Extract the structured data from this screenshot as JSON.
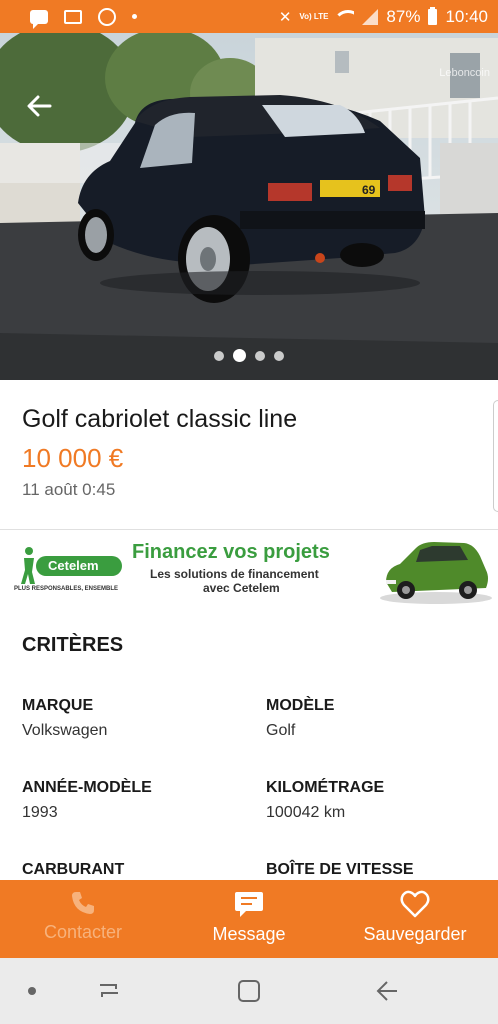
{
  "status_bar": {
    "battery": "87%",
    "time": "10:40",
    "network_label": "Vo) LTE",
    "notification_icons": [
      "chat-icon",
      "news-icon",
      "sync-icon",
      "dot-icon"
    ],
    "system_icons": [
      "mute-icon",
      "lte-icon",
      "wifi-icon",
      "signal-icon",
      "battery-icon"
    ]
  },
  "hero": {
    "watermark": "Leboncoin",
    "image_count": 4,
    "active_index": 1
  },
  "listing": {
    "title": "Golf cabriolet classic line",
    "price": "10 000 €",
    "date": "11 août 0:45",
    "plate": "69"
  },
  "ad": {
    "brand": "Cetelem",
    "tagline": "PLUS RESPONSABLES, ENSEMBLE",
    "headline": "Financez vos projets",
    "sub_line1": "Les solutions de financement",
    "sub_line2": "avec Cetelem"
  },
  "criteria": {
    "section_title": "CRITÈRES",
    "items": [
      {
        "label": "MARQUE",
        "value": "Volkswagen"
      },
      {
        "label": "MODÈLE",
        "value": "Golf"
      },
      {
        "label": "ANNÉE-MODÈLE",
        "value": "1993"
      },
      {
        "label": "KILOMÉTRAGE",
        "value": "100042 km"
      },
      {
        "label": "CARBURANT",
        "value": ""
      },
      {
        "label": "BOÎTE DE VITESSE",
        "value": ""
      }
    ]
  },
  "actions": {
    "contact": "Contacter",
    "message": "Message",
    "save": "Sauvegarder"
  },
  "colors": {
    "brand_orange": "#f07a24",
    "cetelem_green": "#3a9d3f"
  }
}
